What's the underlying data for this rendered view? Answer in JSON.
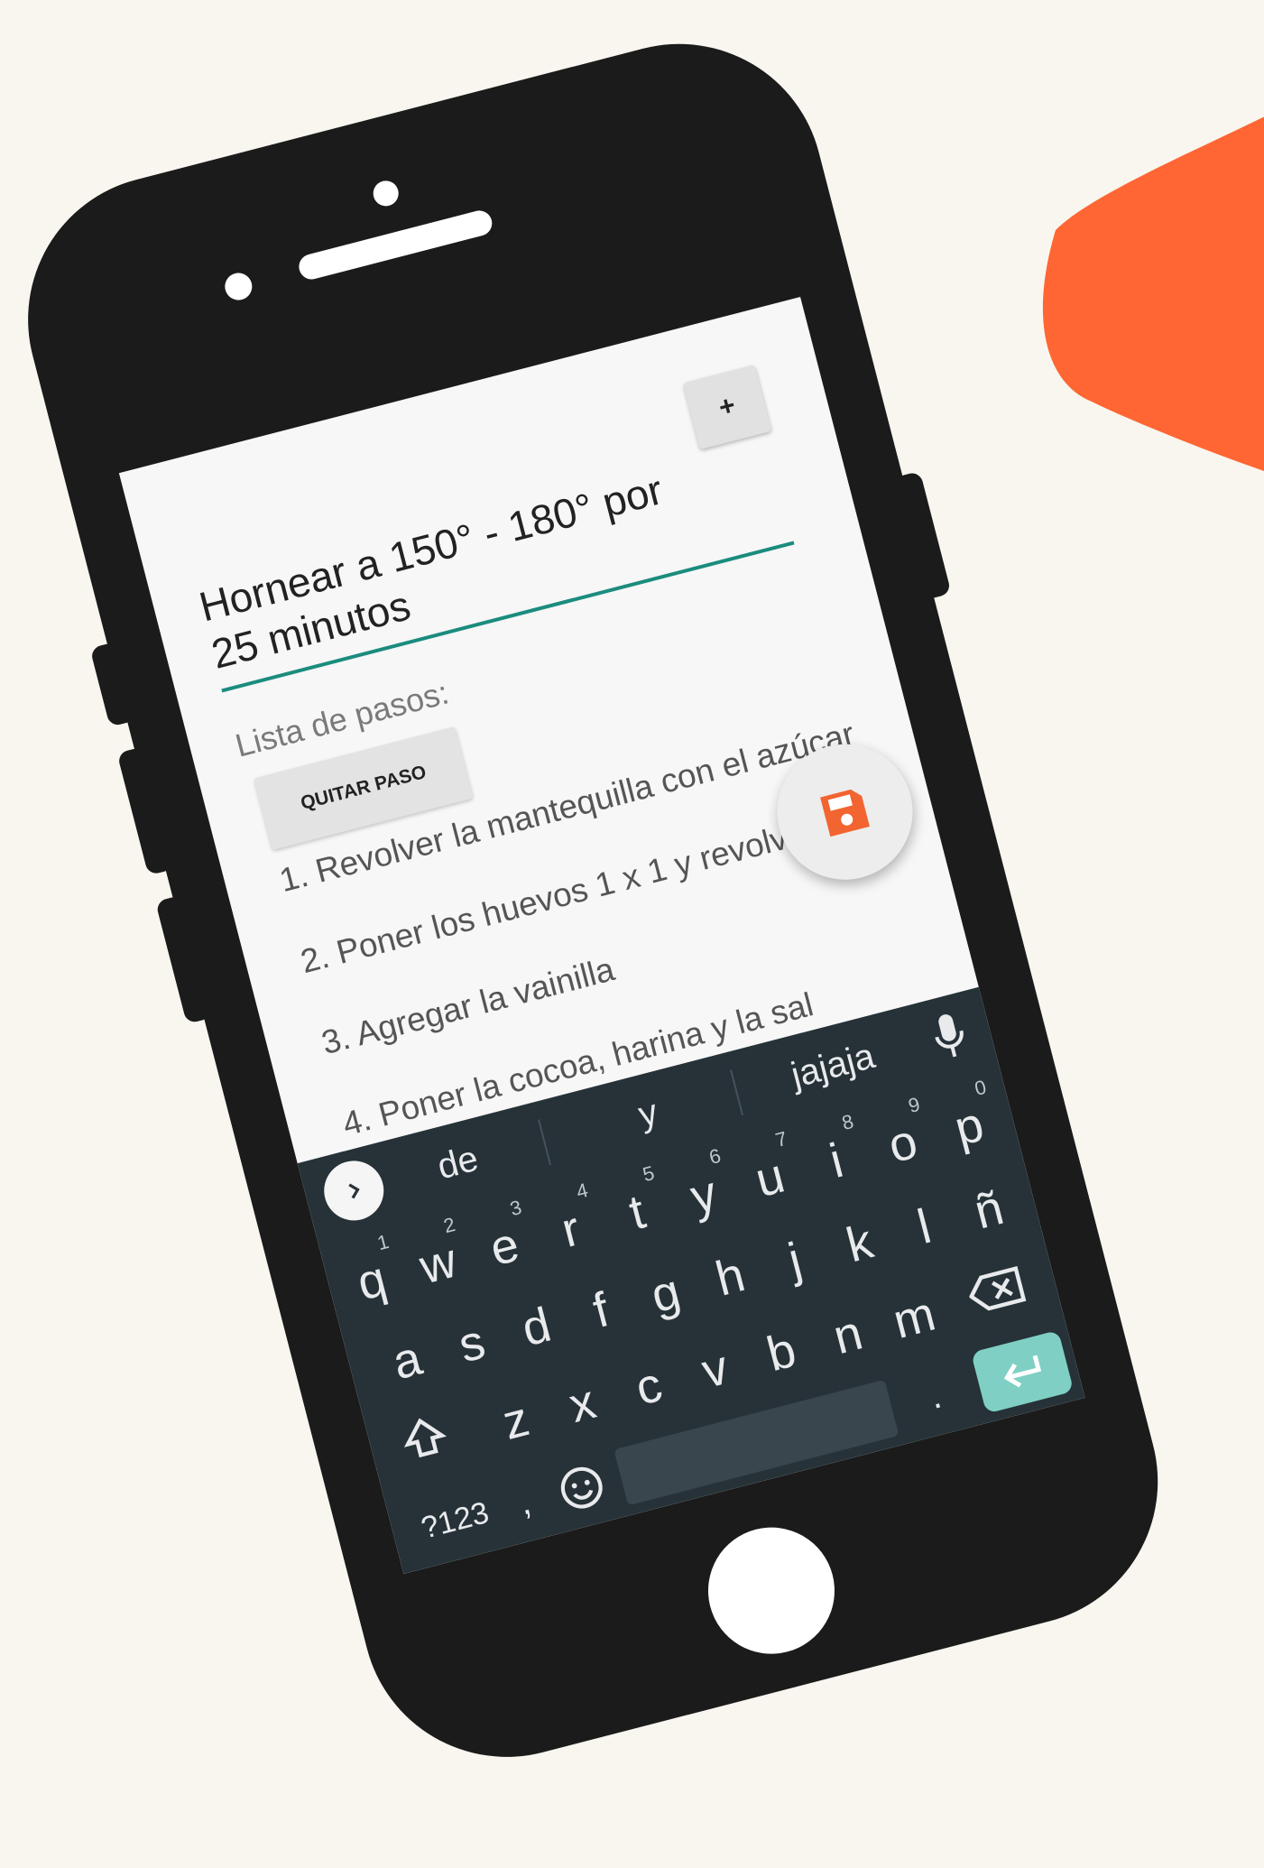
{
  "app": {
    "step_input_value": "Hornear a 150° - 180° por 25 minutos",
    "add_button_label": "+",
    "steps_label": "Lista de pasos:",
    "remove_step_label": "QUITAR PASO",
    "steps": [
      "1. Revolver la mantequilla con el azúcar",
      "2. Poner los huevos 1 x 1 y revolver",
      "3. Agregar la vainilla",
      "4. Poner la cocoa, harina y la sal"
    ],
    "save_icon": "floppy-disk-icon",
    "accent_color": "#f26430"
  },
  "keyboard": {
    "suggestions": [
      "de",
      "y",
      "jajaja"
    ],
    "row1": [
      {
        "l": "q",
        "n": "1"
      },
      {
        "l": "w",
        "n": "2"
      },
      {
        "l": "e",
        "n": "3"
      },
      {
        "l": "r",
        "n": "4"
      },
      {
        "l": "t",
        "n": "5"
      },
      {
        "l": "y",
        "n": "6"
      },
      {
        "l": "u",
        "n": "7"
      },
      {
        "l": "i",
        "n": "8"
      },
      {
        "l": "o",
        "n": "9"
      },
      {
        "l": "p",
        "n": "0"
      }
    ],
    "row2": [
      "a",
      "s",
      "d",
      "f",
      "g",
      "h",
      "j",
      "k",
      "l",
      "ñ"
    ],
    "row3": [
      "z",
      "x",
      "c",
      "v",
      "b",
      "n",
      "m"
    ],
    "symbols_label": "?123",
    "comma_label": ",",
    "period_label": ".",
    "enter_color": "#7fcfc4",
    "background_color": "#263238"
  }
}
